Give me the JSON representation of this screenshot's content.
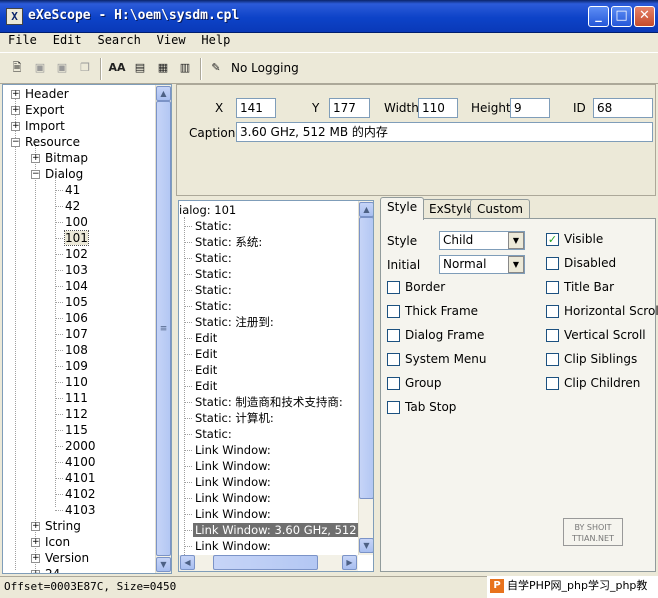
{
  "window": {
    "title": "eXeScope - H:\\oem\\sysdm.cpl",
    "icon_glyph": "X",
    "min_glyph": "_",
    "max_glyph": "□",
    "close_glyph": "✕"
  },
  "menu": [
    "File",
    "Edit",
    "Search",
    "View",
    "Help"
  ],
  "toolbar": {
    "logging_label": "No Logging",
    "font_icon_glyph": "AA"
  },
  "tree": {
    "root_items": [
      "Header",
      "Export",
      "Import",
      "Resource"
    ],
    "resource_items": [
      "Bitmap",
      "Dialog"
    ],
    "dialog_items": [
      "41",
      "42",
      "100",
      "101",
      "102",
      "103",
      "104",
      "105",
      "106",
      "107",
      "108",
      "109",
      "110",
      "111",
      "112",
      "115",
      "2000",
      "4100",
      "4101",
      "4102",
      "4103"
    ],
    "after_dialog": [
      "String",
      "Icon",
      "Version",
      "24"
    ],
    "selected": "101",
    "expanded_sign": "−",
    "collapsed_sign": "+"
  },
  "props": {
    "x_label": "X",
    "x_value": "141",
    "y_label": "Y",
    "y_value": "177",
    "width_label": "Width",
    "width_value": "110",
    "height_label": "Height",
    "height_value": "9",
    "id_label": "ID",
    "id_value": "68",
    "caption_label": "Caption",
    "caption_value": "3.60 GHz,  512 MB 的内存"
  },
  "controls": {
    "header": "ialog: 101",
    "items": [
      "Static:",
      "Static: 系统:",
      "Static:",
      "Static:",
      "Static:",
      "Static:",
      "Static: 注册到:",
      "Edit",
      "Edit",
      "Edit",
      "Edit",
      "Static: 制造商和技术支持商:",
      "Static: 计算机:",
      "Static:",
      "Link Window:",
      "Link Window:",
      "Link Window:",
      "Link Window:",
      "Link Window:",
      "Link Window: 3.60 GHz,  512 MB",
      "Link Window:"
    ],
    "selected_index": 19
  },
  "tabs": {
    "labels": [
      "Style",
      "ExStyle",
      "Custom"
    ],
    "active": 0,
    "style_label": "Style",
    "style_value": "Child",
    "initial_label": "Initial",
    "initial_value": "Normal",
    "left_checks": [
      {
        "label": "Border",
        "checked": false
      },
      {
        "label": "Thick Frame",
        "checked": false
      },
      {
        "label": "Dialog Frame",
        "checked": false
      },
      {
        "label": "System Menu",
        "checked": false
      },
      {
        "label": "Group",
        "checked": false
      },
      {
        "label": "Tab Stop",
        "checked": false
      }
    ],
    "right_checks": [
      {
        "label": "Visible",
        "checked": true
      },
      {
        "label": "Disabled",
        "checked": false
      },
      {
        "label": "Title Bar",
        "checked": false
      },
      {
        "label": "Horizontal Scroll",
        "checked": false
      },
      {
        "label": "Vertical Scroll",
        "checked": false
      },
      {
        "label": "Clip Siblings",
        "checked": false
      },
      {
        "label": "Clip Children",
        "checked": false
      }
    ],
    "check_glyph": "✓",
    "dropdown_glyph": "▼"
  },
  "stamp": {
    "line1": "BY SHOIT",
    "line2": "TTIAN.NET"
  },
  "status": {
    "text": "Offset=0003E87C, Size=0450"
  },
  "watermark": {
    "logo": "P",
    "text": "自学PHP网_php学习_php教"
  },
  "scroll": {
    "up": "▲",
    "down": "▼",
    "left": "◀",
    "right": "▶",
    "grip": "≡"
  }
}
